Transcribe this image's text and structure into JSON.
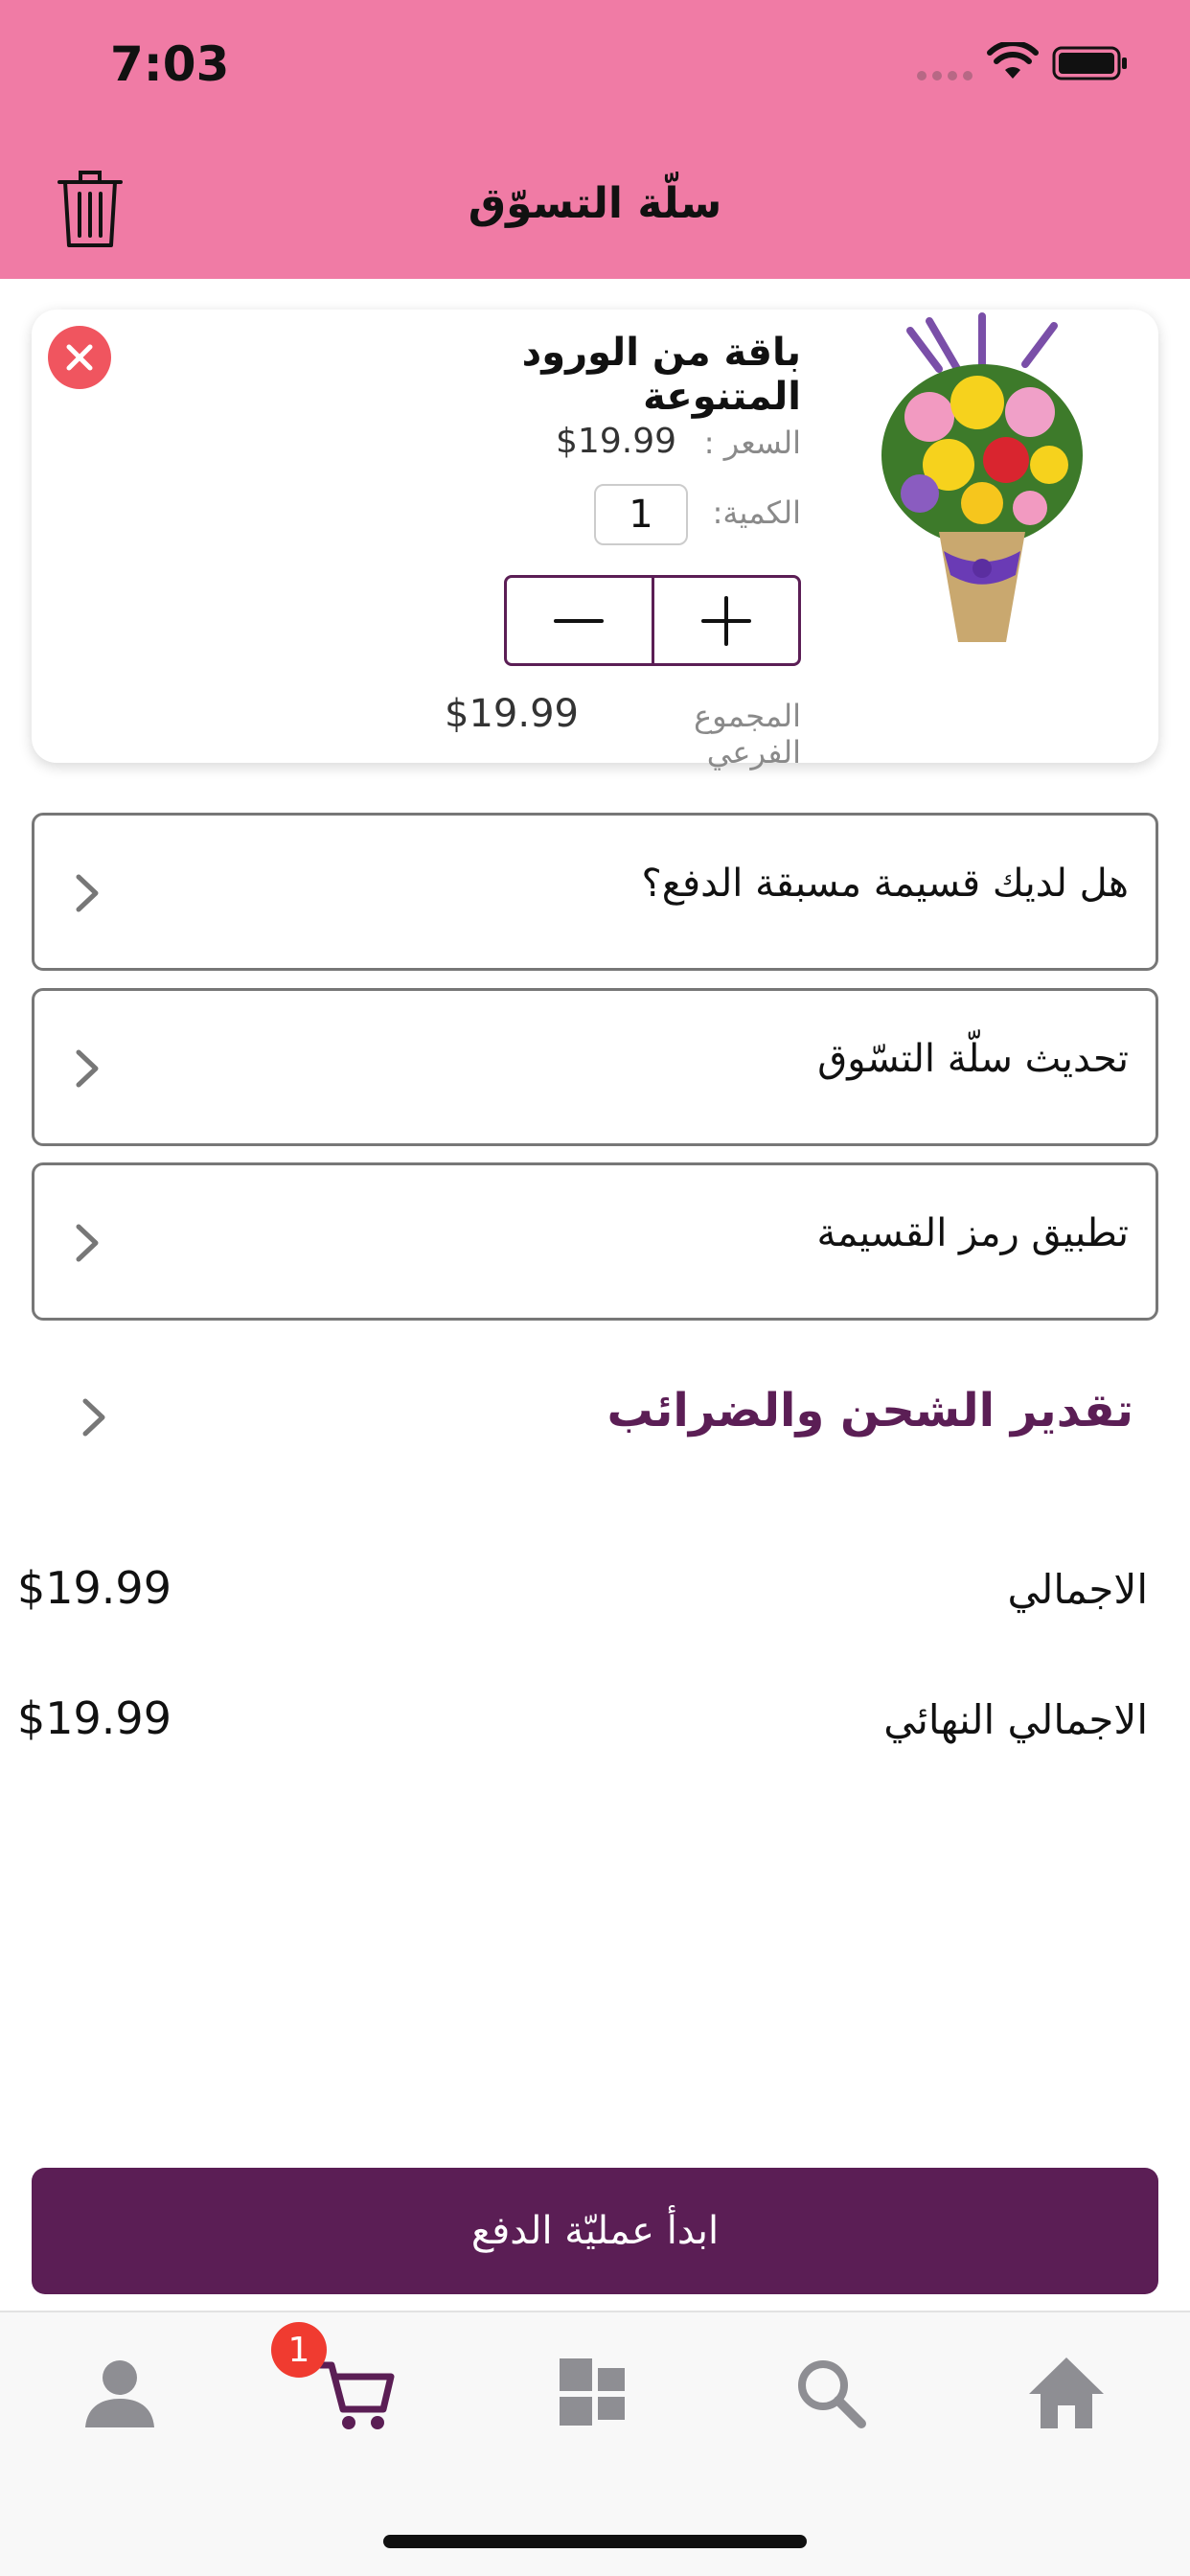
{
  "status_bar": {
    "time": "7:03"
  },
  "header": {
    "title": "سلّة التسوّق"
  },
  "cart_item": {
    "name": "باقة من الورود المتنوعة",
    "price_label": "السعر :",
    "price_value": "$19.99",
    "quantity_label": "الكمية:",
    "quantity_value": "1",
    "subtotal_label": "المجموع الفرعي",
    "subtotal_value": "$19.99"
  },
  "options": [
    {
      "label": "هل لديك قسيمة مسبقة الدفع؟"
    },
    {
      "label": "تحديث سلّة التسّوق"
    },
    {
      "label": "تطبيق رمز القسيمة"
    }
  ],
  "shipping": {
    "label": "تقدير الشحن والضرائب"
  },
  "totals": {
    "total_label": "الاجمالي",
    "total_value": "$19.99",
    "final_label": "الاجمالي النهائي",
    "final_value": "$19.99"
  },
  "checkout": {
    "label": "ابدأ عمليّة الدفع"
  },
  "tab_bar": {
    "cart_badge": "1",
    "tabs": [
      {
        "icon": "person-icon"
      },
      {
        "icon": "cart-icon"
      },
      {
        "icon": "categories-icon"
      },
      {
        "icon": "search-icon"
      },
      {
        "icon": "home-icon"
      }
    ]
  },
  "colors": {
    "header_bg": "#F07BA5",
    "accent": "#5B1E55",
    "remove": "#F0555F",
    "badge": "#F03B30"
  }
}
